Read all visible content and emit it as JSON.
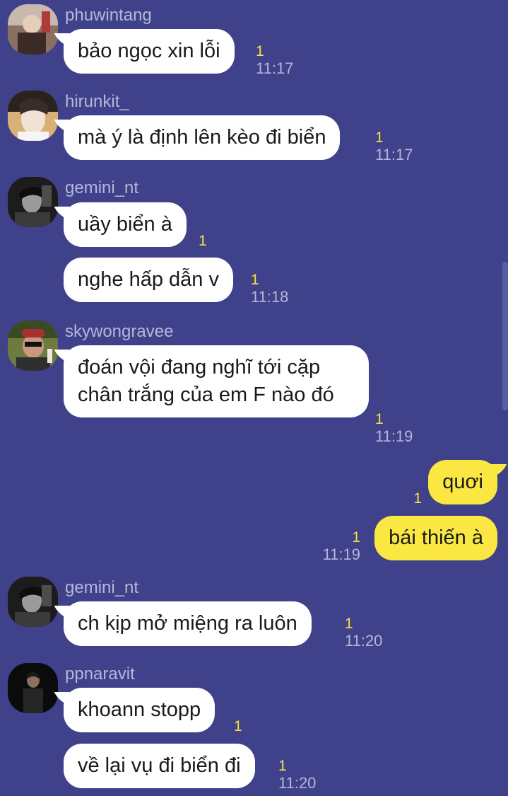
{
  "theme": {
    "background": "#3f418a",
    "bubble_incoming": "#ffffff",
    "bubble_outgoing": "#fbe742",
    "unread_color": "#f6e33a",
    "meta_text": "#b5b7d9"
  },
  "messages": [
    {
      "sender": "phuwintang",
      "text": "bảo ngọc xin lỗi",
      "unread": "1",
      "time": "11:17"
    },
    {
      "sender": "hirunkit_",
      "text": "mà ý là định lên kèo đi biển",
      "unread": "1",
      "time": "11:17"
    },
    {
      "sender": "gemini_nt",
      "text": "uầy biển à",
      "unread": "1"
    },
    {
      "text": "nghe hấp dẫn v",
      "unread": "1",
      "time": "11:18"
    },
    {
      "sender": "skywongravee",
      "text": "đoán vội đang nghĩ tới cặp chân trắng của em F nào đó",
      "unread": "1",
      "time": "11:19"
    },
    {
      "text": "quơi",
      "unread": "1",
      "outgoing": true
    },
    {
      "text": "bái thiến à",
      "unread": "1",
      "time": "11:19",
      "outgoing": true
    },
    {
      "sender": "gemini_nt",
      "text": "ch kịp mở miệng ra luôn",
      "unread": "1",
      "time": "11:20"
    },
    {
      "sender": "ppnaravit",
      "text": "khoann stopp",
      "unread": "1"
    },
    {
      "text": "về lại vụ đi biển đi",
      "unread": "1",
      "time": "11:20"
    }
  ]
}
